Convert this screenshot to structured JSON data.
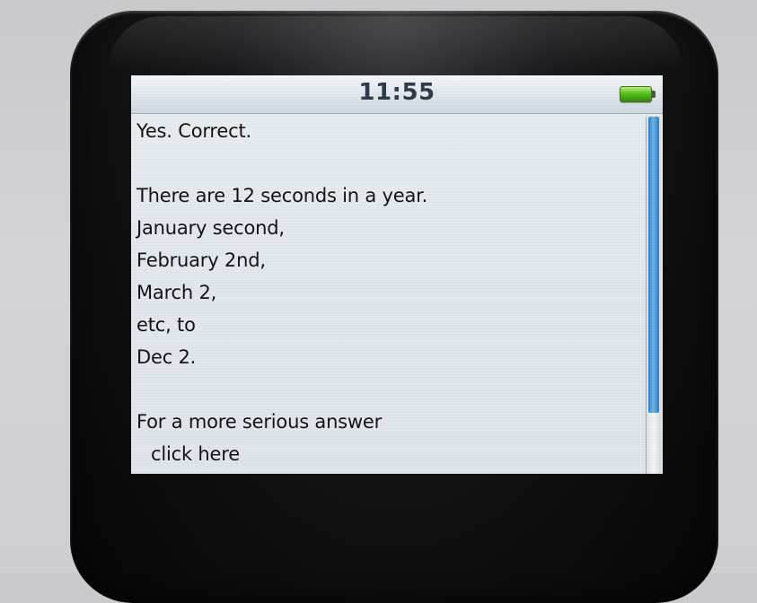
{
  "status_bar": {
    "time": "11:55",
    "battery_icon": "battery-full-icon",
    "battery_color": "#58c21e"
  },
  "note": {
    "lines": [
      "Yes. Correct.",
      "There are 12 seconds in a year.",
      "January second,",
      "February 2nd,",
      "March 2,",
      "etc, to",
      "Dec 2.",
      "For a more serious answer"
    ],
    "link_text": "click here"
  },
  "scrollbar": {
    "thumb_color": "#2f7fc4",
    "position_fraction": 0.0,
    "visible_fraction": 0.83
  }
}
